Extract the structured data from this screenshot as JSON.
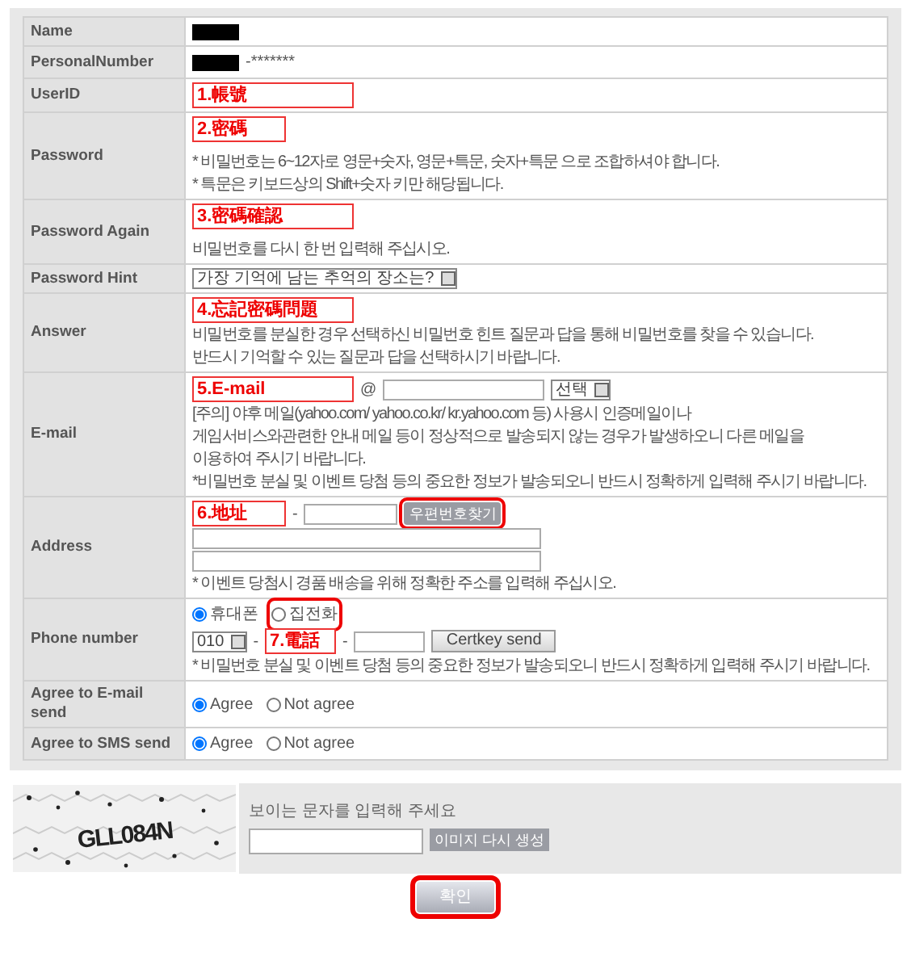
{
  "form_rows": [
    {
      "label": "Name",
      "lines": [
        [
          {
            "kind": "redacted"
          }
        ]
      ]
    },
    {
      "label": "PersonalNumber",
      "lines": [
        [
          {
            "kind": "redacted"
          },
          {
            "kind": "text",
            "text": "-*******"
          }
        ]
      ]
    },
    {
      "label": "UserID",
      "lines": [
        [
          {
            "kind": "input",
            "value": "1.帳號",
            "annotated": true
          }
        ]
      ]
    },
    {
      "label": "Password",
      "lines": [
        [
          {
            "kind": "shortinput",
            "value": "2.密碼",
            "annotated": true
          }
        ],
        [
          {
            "kind": "spacer"
          }
        ],
        [
          {
            "kind": "note",
            "text": "* 비밀번호는 6~12자로 영문+숫자, 영문+특문, 숫자+특문 으로 조합하셔야 합니다."
          }
        ],
        [
          {
            "kind": "note",
            "text": "* 특문은 키보드상의 Shift+숫자 키만 해당됩니다."
          }
        ]
      ]
    },
    {
      "label": "Password Again",
      "lines": [
        [
          {
            "kind": "input",
            "value": "3.密碼確認",
            "annotated": true
          }
        ],
        [
          {
            "kind": "spacer"
          }
        ],
        [
          {
            "kind": "note",
            "text": "비밀번호를 다시 한 번 입력해 주십시오."
          }
        ]
      ]
    },
    {
      "label": "Password Hint",
      "lines": [
        [
          {
            "kind": "select",
            "value": "가장 기억에 남는 추억의 장소는?"
          }
        ]
      ]
    },
    {
      "label": "Answer",
      "lines": [
        [
          {
            "kind": "input",
            "value": "4.忘記密碼問題",
            "annotated": true
          }
        ],
        [
          {
            "kind": "note",
            "text": "비밀번호를 분실한 경우 선택하신 비밀번호 힌트 질문과 답을 통해 비밀번호를 찾을 수 있습니다."
          }
        ],
        [
          {
            "kind": "note",
            "text": "반드시 기억할 수 있는 질문과 답을 선택하시기 바랍니다."
          }
        ]
      ]
    },
    {
      "label": "E-mail",
      "lines": [
        [
          {
            "kind": "input",
            "value": "5.E-mail",
            "annotated": true
          },
          {
            "kind": "text",
            "text": "@"
          },
          {
            "kind": "input"
          },
          {
            "kind": "select",
            "value": "선택"
          }
        ],
        [
          {
            "kind": "note",
            "text": "[주의] 야후 메일(yahoo.com/ yahoo.co.kr/ kr.yahoo.com 등) 사용시 인증메일이나"
          }
        ],
        [
          {
            "kind": "note",
            "text": "게임서비스와관련한 안내 메일 등이 정상적으로 발송되지 않는 경우가 발생하오니 다른 메일을"
          }
        ],
        [
          {
            "kind": "note",
            "text": "이용하여 주시기 바랍니다."
          }
        ],
        [
          {
            "kind": "note",
            "text": "*비밀번호 분실 및 이벤트 당첨 등의 중요한 정보가 발송되오니 반드시 정확하게 입력해 주시기 바랍니다."
          }
        ]
      ]
    },
    {
      "label": "Address",
      "lines": [
        [
          {
            "kind": "shortinput",
            "value": "6.地址",
            "annotated": true
          },
          {
            "kind": "text",
            "text": "-"
          },
          {
            "kind": "shortinput"
          },
          {
            "kind": "tagbutton",
            "label": "우편번호찾기",
            "highlighted": true
          }
        ],
        [
          {
            "kind": "longinput"
          }
        ],
        [
          {
            "kind": "longinput"
          }
        ],
        [
          {
            "kind": "note",
            "text": "* 이벤트 당첨시 경품 배송을 위해 정확한 주소를 입력해 주십시오."
          }
        ]
      ]
    },
    {
      "label": "Phone number",
      "lines": [
        [
          {
            "kind": "radio",
            "label": "휴대폰",
            "checked": true,
            "highlighted": false
          },
          {
            "kind": "radio",
            "label": "집전화",
            "checked": false,
            "highlighted": true
          }
        ],
        [
          {
            "kind": "select",
            "value": "010"
          },
          {
            "kind": "text",
            "text": "-"
          },
          {
            "kind": "tinyinput",
            "value": "7.電話",
            "annotated": true
          },
          {
            "kind": "text",
            "text": "-"
          },
          {
            "kind": "tinyinput"
          },
          {
            "kind": "button",
            "label": "Certkey send",
            "highlighted": false
          }
        ],
        [
          {
            "kind": "note",
            "text": "* 비밀번호 분실 및 이벤트 당첨 등의 중요한 정보가 발송되오니 반드시 정확하게 입력해 주시기 바랍니다."
          }
        ]
      ]
    },
    {
      "label": "Agree to E-mail send",
      "lines": [
        [
          {
            "kind": "radio",
            "label": "Agree",
            "checked": true,
            "highlighted": false
          },
          {
            "kind": "radio",
            "label": "Not agree",
            "checked": false,
            "highlighted": false
          }
        ]
      ]
    },
    {
      "label": "Agree to SMS send",
      "lines": [
        [
          {
            "kind": "radio",
            "label": "Agree",
            "checked": true,
            "highlighted": false
          },
          {
            "kind": "radio",
            "label": "Not agree",
            "checked": false,
            "highlighted": false
          }
        ]
      ]
    }
  ],
  "captcha": {
    "captcha_text": "GLL084N",
    "prompt": "보이는 문자를 입력해 주세요",
    "refresh_button": "이미지 다시 생성"
  },
  "submit": {
    "label": "확인",
    "highlighted": true
  }
}
